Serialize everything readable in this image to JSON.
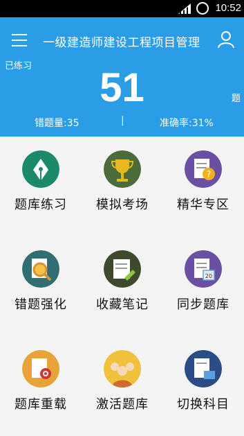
{
  "status": {
    "time": "10:52"
  },
  "header": {
    "title": "一级建造师建设工程项目管理",
    "practiced_label": "已练习",
    "practiced_count": "51",
    "unit": "题",
    "wrong_count": "错题量:35",
    "separator": "|",
    "accuracy": "准确率:31%"
  },
  "colors": {
    "header": "#2a9de6"
  },
  "menu": [
    {
      "label": "题库练习",
      "icon": "pen-nib-icon"
    },
    {
      "label": "模拟考场",
      "icon": "trophy-icon"
    },
    {
      "label": "精华专区",
      "icon": "document-question-icon"
    },
    {
      "label": "错题强化",
      "icon": "magnifier-document-icon"
    },
    {
      "label": "收藏笔记",
      "icon": "notes-pencil-icon"
    },
    {
      "label": "同步题库",
      "icon": "calendar-document-icon"
    },
    {
      "label": "题库重载",
      "icon": "document-target-icon"
    },
    {
      "label": "激活题库",
      "icon": "people-group-icon"
    },
    {
      "label": "切换科目",
      "icon": "document-keyboard-icon"
    }
  ]
}
